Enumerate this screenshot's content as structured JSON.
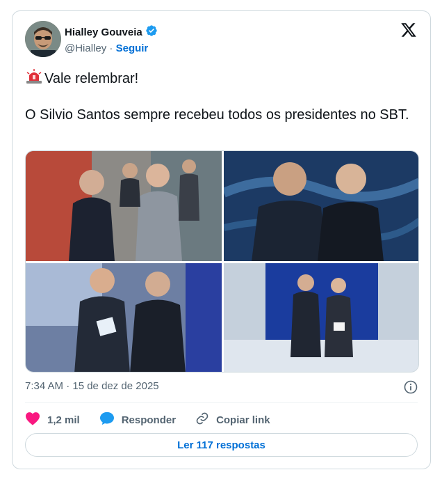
{
  "author": {
    "name": "Hialley Gouveia",
    "handle": "@Hialley",
    "separator": "·",
    "follow_label": "Seguir",
    "verified_icon": "verified-badge-icon"
  },
  "tweet": {
    "emoji_icon": "police-light-icon",
    "line1": "Vale relembrar!",
    "line2": "O Silvio Santos sempre recebeu todos os presidentes no SBT."
  },
  "meta": {
    "timestamp": "7:34 AM · 15 de dez de 2025"
  },
  "actions": {
    "likes": "1,2 mil",
    "reply_label": "Responder",
    "copy_label": "Copiar link"
  },
  "read_replies_label": "Ler 117 respostas",
  "colors": {
    "accent": "#006fd6",
    "like": "#f91880",
    "reply": "#1d9bf0",
    "muted": "#536471"
  }
}
